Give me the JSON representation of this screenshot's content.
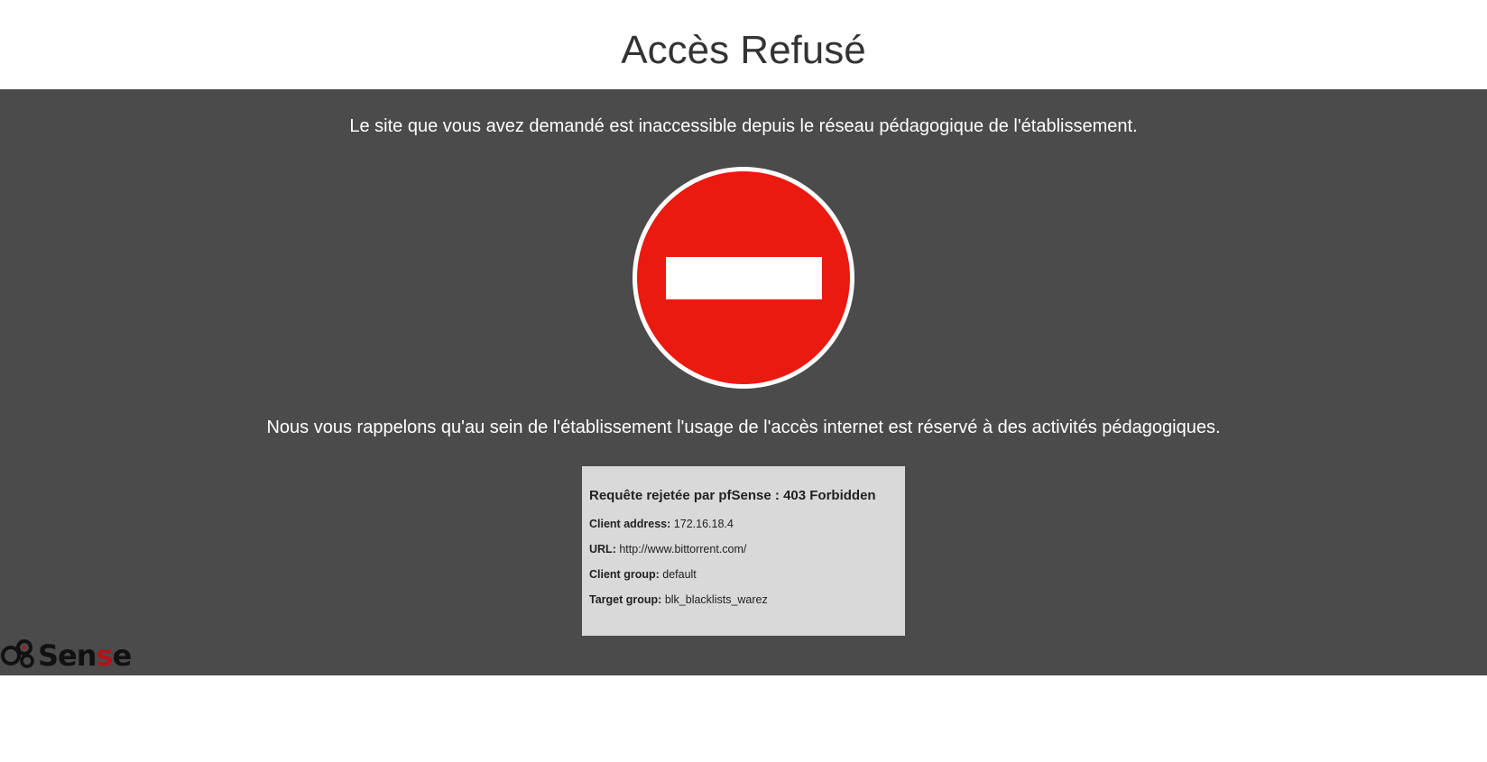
{
  "header": {
    "title": "Accès Refusé"
  },
  "main": {
    "message_top": "Le site que vous avez demandé est inaccessible depuis le réseau pédagogique de l'établissement.",
    "message_bottom": "Nous vous rappelons qu'au sein de l'établissement l'usage de l'accès internet est réservé à des activités pédagogiques.",
    "sign_icon": "no-entry-icon",
    "colors": {
      "band": "#4b4b4b",
      "sign_red": "#ea1a10",
      "info_bg": "#d9d9d9"
    }
  },
  "info": {
    "title": "Requête rejetée par pfSense : 403 Forbidden",
    "client_address_label": "Client address:",
    "client_address": "172.16.18.4",
    "url_label": "URL:",
    "url": "http://www.bittorrent.com/",
    "client_group_label": "Client group:",
    "client_group": "default",
    "target_group_label": "Target group:",
    "target_group": "blk_blacklists_warez"
  },
  "logo": {
    "icon": "pfsense-logo-icon",
    "text_prefix": "Sen",
    "text_accent": "s",
    "text_suffix": "e",
    "accent_color": "#b3121a"
  }
}
